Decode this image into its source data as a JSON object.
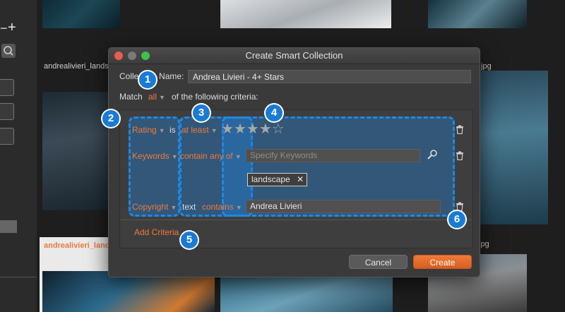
{
  "background": {
    "left_panel": {
      "plus_icon": "+",
      "search_icon": "search-icon"
    },
    "grid_labels": {
      "top_left_name": "andrealivieri_landsca",
      "bottom_left_name": "andrealivieri_lands",
      "right_ext_top": ".jpg",
      "right_ext_bottom": "jpg"
    }
  },
  "dialog": {
    "title": "Create Smart Collection",
    "collection_name_label": "Collection Name:",
    "collection_name_value": "Andrea Livieri - 4+ Stars",
    "match_label": "Match",
    "match_value": "all",
    "match_suffix": "of the following criteria:",
    "criteria": [
      {
        "field": "Rating",
        "prefix": "is",
        "operator": "at least",
        "stars_filled": 4,
        "stars_total": 5
      },
      {
        "field": "Keywords",
        "operator": "contain any of",
        "placeholder": "Specify Keywords",
        "tag": "landscape"
      },
      {
        "field": "Copyright",
        "type_label": "text",
        "operator": "contains",
        "value": "Andrea Livieri"
      }
    ],
    "add_criteria": "Add Criteria",
    "cancel": "Cancel",
    "create": "Create"
  },
  "badges": [
    "1",
    "2",
    "3",
    "4",
    "5",
    "6"
  ],
  "colors": {
    "accent": "#f07a3a",
    "highlight": "#1e88e5",
    "badge": "#1a7bd6"
  }
}
